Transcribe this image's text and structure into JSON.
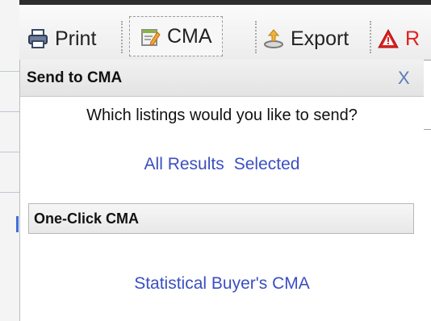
{
  "toolbar": {
    "print_label": "Print",
    "cma_label": "CMA",
    "export_label": "Export",
    "alert_label_partial": "R",
    "icons": {
      "print": "printer-icon",
      "cma": "edit-document-icon",
      "export": "export-tray-icon",
      "alert": "warning-triangle-icon"
    }
  },
  "dialog": {
    "title": "Send to CMA",
    "close_label": "X",
    "question": "Which listings would you like to send?",
    "links": {
      "all_results": "All Results",
      "selected": "Selected"
    },
    "section": {
      "title": "One-Click CMA",
      "link": "Statistical Buyer's CMA"
    }
  },
  "colors": {
    "link": "#3b4fc0",
    "alert": "#e02020",
    "header_bg": "#e8e8e8"
  }
}
